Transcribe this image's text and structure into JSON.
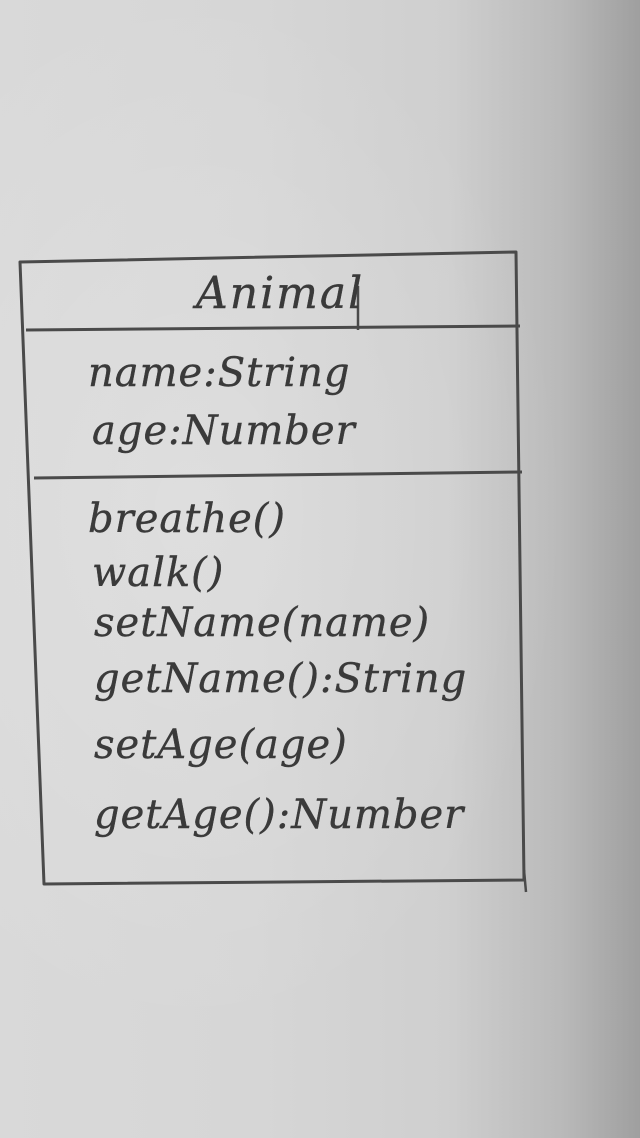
{
  "uml_class": {
    "name": "Animal",
    "attributes": [
      "name:String",
      "age:Number"
    ],
    "operations": [
      "breathe()",
      "walk()",
      "setName(name)",
      "getName():String",
      "setAge(age)",
      "getAge():Number"
    ]
  },
  "style": {
    "ink_color": "#3a3a3a",
    "paper_color": "#d6d6d6"
  }
}
